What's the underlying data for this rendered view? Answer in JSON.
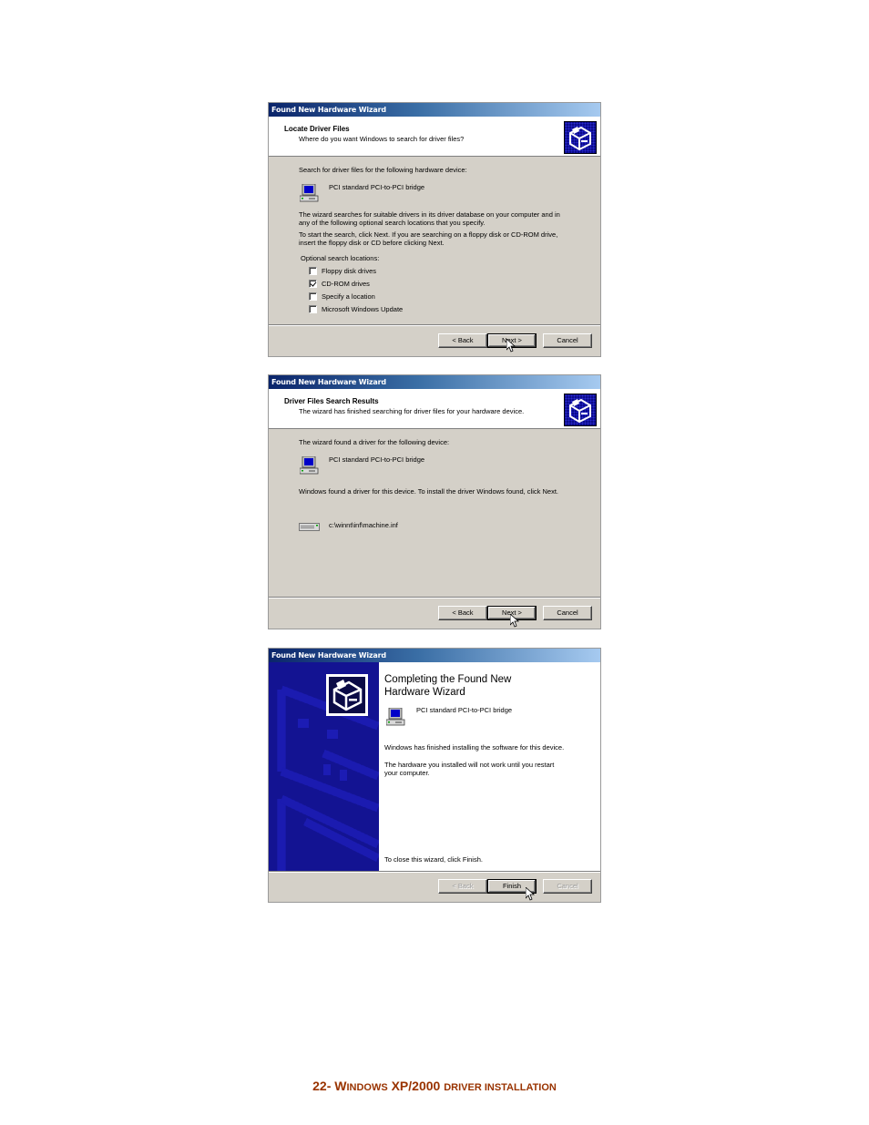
{
  "dialogs": [
    {
      "title": "Found New Hardware Wizard",
      "header_title": "Locate Driver Files",
      "header_subtitle": "Where do you want Windows to search for driver files?",
      "intro": "Search for driver files for the following hardware device:",
      "device_name": "PCI standard PCI-to-PCI bridge",
      "para1_line1": "The wizard searches for suitable drivers in its driver database on your computer and in",
      "para1_line2": "any of the following optional search locations that you specify.",
      "para2_line1": "To start the search, click Next. If you are searching on a floppy disk or CD-ROM drive,",
      "para2_line2": "insert the floppy disk or CD before clicking Next.",
      "optional_label": "Optional search locations:",
      "options": [
        {
          "label": "Floppy disk drives",
          "checked": false
        },
        {
          "label": "CD-ROM drives",
          "checked": true
        },
        {
          "label": "Specify a location",
          "checked": false
        },
        {
          "label": "Microsoft Windows Update",
          "checked": false
        }
      ],
      "buttons": {
        "back": "< Back",
        "next": "Next >",
        "cancel": "Cancel"
      }
    },
    {
      "title": "Found New Hardware Wizard",
      "header_title": "Driver Files Search Results",
      "header_subtitle": "The wizard has finished searching for driver files for your hardware device.",
      "intro": "The wizard found a driver for the following device:",
      "device_name": "PCI standard PCI-to-PCI bridge",
      "found_text": "Windows found a driver for this device. To install the driver Windows found, click Next.",
      "driver_path": "c:\\winnt\\inf\\machine.inf",
      "buttons": {
        "back": "< Back",
        "next": "Next >",
        "cancel": "Cancel"
      }
    },
    {
      "title": "Found New Hardware Wizard",
      "heading_line1": "Completing the Found New",
      "heading_line2": "Hardware Wizard",
      "device_name": "PCI standard PCI-to-PCI bridge",
      "finished_text": "Windows has finished installing the software for this device.",
      "restart_line1": "The hardware you installed will not work until you restart",
      "restart_line2": "your computer.",
      "close_text": "To close this wizard, click Finish.",
      "buttons": {
        "back": "< Back",
        "finish": "Finish",
        "cancel": "Cancel"
      }
    }
  ],
  "page_footer": {
    "number": "22-",
    "w_initial": "W",
    "w_rest": "INDOWS",
    "xp": "XP/2000",
    "rest": "DRIVER INSTALLATION"
  }
}
